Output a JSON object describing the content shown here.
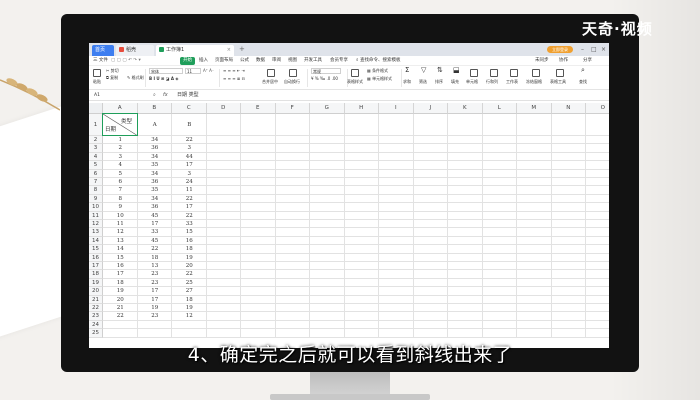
{
  "watermark": "天奇·视频",
  "subtitle": "4、确定完之后就可以看到斜线出来了",
  "tabs": {
    "home": "首页",
    "daoke": "稻壳",
    "doc": "工作簿1"
  },
  "login_label": "立即登录",
  "menu": {
    "file": "三 文件",
    "start": "开始",
    "insert": "插入",
    "page_layout": "页面布局",
    "formula": "公式",
    "data": "数据",
    "review": "审阅",
    "view": "视图",
    "dev_tools": "开发工具",
    "member": "会员专享",
    "search": "查找命令、搜索模板",
    "unsync": "未同步",
    "collab": "协作",
    "share": "分享"
  },
  "ribbon": {
    "paste": "粘贴",
    "cut": "剪切",
    "copy": "复制",
    "format_painter": "格式刷",
    "font_name": "宋体",
    "font_size": "11",
    "merge_center": "合并居中",
    "wrap": "自动换行",
    "number_format": "常规",
    "cond_format": "条件格式",
    "table_style": "表格样式",
    "cell_style": "单元格样式",
    "sum": "求和",
    "filter": "筛选",
    "sort": "排序",
    "fill": "填充",
    "cell": "单元格",
    "row_col": "行和列",
    "worksheet": "工作表",
    "freeze": "冻结窗格",
    "table_tools": "表格工具",
    "find": "查找"
  },
  "formula_bar": {
    "name_box": "A1",
    "content": "日期  类型"
  },
  "columns": [
    "A",
    "B",
    "C",
    "D",
    "E",
    "F",
    "G",
    "H",
    "I",
    "J",
    "K",
    "L",
    "M",
    "N",
    "O"
  ],
  "header_row": {
    "row_num": "1",
    "a_left": "日期",
    "a_right": "类型",
    "b": "A",
    "c": "B"
  },
  "rows": [
    {
      "n": "2",
      "a": "1",
      "b": "34",
      "c": "22"
    },
    {
      "n": "3",
      "a": "2",
      "b": "36",
      "c": "3"
    },
    {
      "n": "4",
      "a": "3",
      "b": "34",
      "c": "44"
    },
    {
      "n": "5",
      "a": "4",
      "b": "35",
      "c": "17"
    },
    {
      "n": "6",
      "a": "5",
      "b": "34",
      "c": "3"
    },
    {
      "n": "7",
      "a": "6",
      "b": "36",
      "c": "24"
    },
    {
      "n": "8",
      "a": "7",
      "b": "35",
      "c": "11"
    },
    {
      "n": "9",
      "a": "8",
      "b": "34",
      "c": "22"
    },
    {
      "n": "10",
      "a": "9",
      "b": "36",
      "c": "17"
    },
    {
      "n": "11",
      "a": "10",
      "b": "45",
      "c": "22"
    },
    {
      "n": "12",
      "a": "11",
      "b": "17",
      "c": "33"
    },
    {
      "n": "13",
      "a": "12",
      "b": "33",
      "c": "15"
    },
    {
      "n": "14",
      "a": "13",
      "b": "45",
      "c": "16"
    },
    {
      "n": "15",
      "a": "14",
      "b": "22",
      "c": "18"
    },
    {
      "n": "16",
      "a": "15",
      "b": "18",
      "c": "19"
    },
    {
      "n": "17",
      "a": "16",
      "b": "13",
      "c": "20"
    },
    {
      "n": "18",
      "a": "17",
      "b": "23",
      "c": "22"
    },
    {
      "n": "19",
      "a": "18",
      "b": "23",
      "c": "25"
    },
    {
      "n": "20",
      "a": "19",
      "b": "17",
      "c": "27"
    },
    {
      "n": "21",
      "a": "20",
      "b": "17",
      "c": "18"
    },
    {
      "n": "22",
      "a": "21",
      "b": "19",
      "c": "19"
    },
    {
      "n": "23",
      "a": "22",
      "b": "23",
      "c": "12"
    },
    {
      "n": "24",
      "a": "",
      "b": "",
      "c": ""
    },
    {
      "n": "25",
      "a": "",
      "b": "",
      "c": ""
    }
  ],
  "colors": {
    "accent_green": "#1f9e5a",
    "tab_blue": "#3d7ef0",
    "login_orange": "#f0a030"
  }
}
